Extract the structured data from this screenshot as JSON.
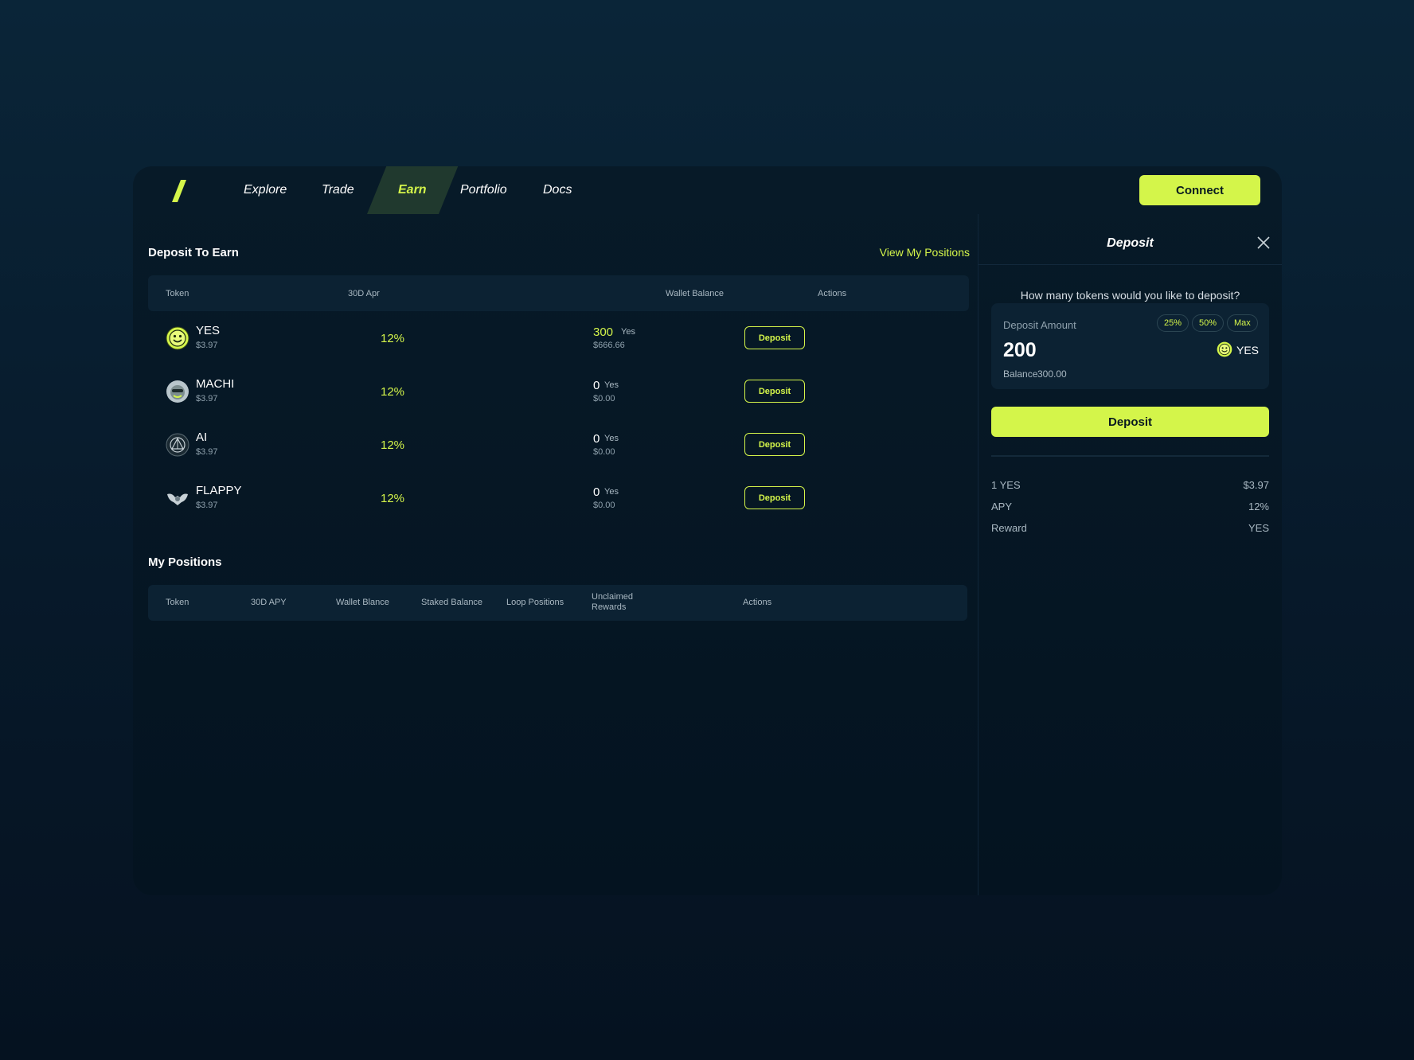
{
  "nav": {
    "items": [
      {
        "label": "Explore"
      },
      {
        "label": "Trade"
      },
      {
        "label": "Earn"
      },
      {
        "label": "Portfolio"
      },
      {
        "label": "Docs"
      }
    ],
    "active": "Earn",
    "connect_label": "Connect"
  },
  "deposit_section": {
    "title": "Deposit To Earn",
    "view_link": "View My Positions",
    "columns": [
      "Token",
      "30D Apr",
      "Wallet Balance",
      "Actions"
    ],
    "rows": [
      {
        "token": "YES",
        "price": "$3.97",
        "apr": "12%",
        "balance": "300",
        "unit": "Yes",
        "usd": "$666.66",
        "action": "Deposit"
      },
      {
        "token": "MACHI",
        "price": "$3.97",
        "apr": "12%",
        "balance": "0",
        "unit": "Yes",
        "usd": "$0.00",
        "action": "Deposit"
      },
      {
        "token": "AI",
        "price": "$3.97",
        "apr": "12%",
        "balance": "0",
        "unit": "Yes",
        "usd": "$0.00",
        "action": "Deposit"
      },
      {
        "token": "FLAPPY",
        "price": "$3.97",
        "apr": "12%",
        "balance": "0",
        "unit": "Yes",
        "usd": "$0.00",
        "action": "Deposit"
      }
    ]
  },
  "positions_section": {
    "title": "My Positions",
    "columns": [
      "Token",
      "30D APY",
      "Wallet Blance",
      "Staked Balance",
      "Loop Positions",
      "Unclaimed",
      "Rewards",
      "Actions"
    ]
  },
  "deposit_panel": {
    "title": "Deposit",
    "question": "How many tokens would you like to deposit?",
    "amount_label": "Deposit Amount",
    "presets": [
      "25%",
      "50%",
      "Max"
    ],
    "amount": "200",
    "token": "YES",
    "balance_label": "Balance",
    "balance_value": "300.00",
    "button_label": "Deposit",
    "info": [
      {
        "key": "1 YES",
        "value": "$3.97"
      },
      {
        "key": "APY",
        "value": "12%"
      },
      {
        "key": "Reward",
        "value": "YES"
      }
    ]
  },
  "colors": {
    "accent": "#d4f54a",
    "background": "#0a2538",
    "panel": "#0c2233"
  }
}
